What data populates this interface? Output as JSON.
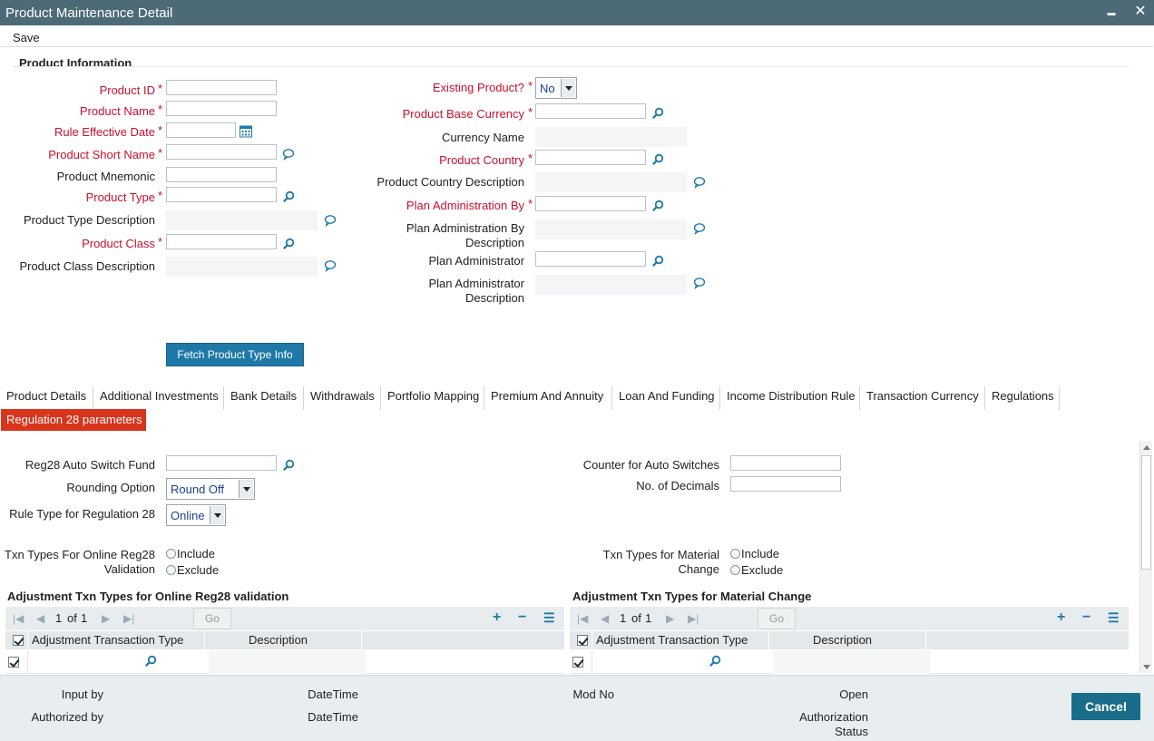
{
  "window": {
    "title": "Product Maintenance Detail",
    "minimize_glyph": "▬",
    "close_glyph": "✕"
  },
  "menu": {
    "save_label": "Save"
  },
  "product_info": {
    "section_title": "Product Information",
    "left": {
      "product_id": "Product ID",
      "product_name": "Product Name",
      "rule_effective_date": "Rule Effective Date",
      "product_short_name": "Product Short Name",
      "product_mnemonic": "Product Mnemonic",
      "product_type": "Product Type",
      "product_type_description": "Product Type Description",
      "product_class": "Product Class",
      "product_class_description": "Product Class Description"
    },
    "right": {
      "existing_product": "Existing Product?",
      "existing_product_value": "No",
      "product_base_currency": "Product Base Currency",
      "currency_name": "Currency Name",
      "product_country": "Product Country",
      "product_country_description": "Product Country Description",
      "plan_administration_by": "Plan Administration By",
      "plan_administration_by_description_1": "Plan Administration By",
      "plan_administration_by_description_2": "Description",
      "plan_administrator": "Plan Administrator",
      "plan_administrator_description_1": "Plan Administrator",
      "plan_administrator_description_2": "Description"
    },
    "required_star": "*",
    "fetch_button": "Fetch Product Type Info"
  },
  "tabs": [
    "Product Details",
    "Additional Investments",
    "Bank Details",
    "Withdrawals",
    "Portfolio Mapping",
    "Premium And Annuity",
    "Loan And Funding",
    "Income Distribution Rule",
    "Transaction Currency",
    "Regulations"
  ],
  "subtab": "Regulation 28 parameters",
  "reg28": {
    "auto_switch_fund": "Reg28 Auto Switch Fund",
    "rounding_option": "Rounding Option",
    "rounding_value": "Round Off",
    "rule_type": "Rule Type for Regulation 28",
    "rule_type_value": "Online",
    "counter_auto_switches": "Counter for Auto Switches",
    "no_of_decimals": "No. of Decimals",
    "txn_online_1": "Txn Types For Online Reg28",
    "txn_online_2": "Validation",
    "txn_material_1": "Txn Types for Material",
    "txn_material_2": "Change",
    "include": "Include",
    "exclude": "Exclude"
  },
  "grids": {
    "left_title": "Adjustment Txn Types for Online Reg28 validation",
    "right_title": "Adjustment Txn Types for Material Change",
    "page": "1",
    "of_label": "of",
    "total": "1",
    "go": "Go",
    "col_type": "Adjustment Transaction Type",
    "col_desc": "Description"
  },
  "footer": {
    "input_by": "Input by",
    "authorized_by": "Authorized by",
    "datetime1": "DateTime",
    "datetime2": "DateTime",
    "mod_no": "Mod No",
    "open": "Open",
    "auth_status_1": "Authorization",
    "auth_status_2": "Status",
    "cancel": "Cancel"
  },
  "colors": {
    "titlebar": "#4d6b77",
    "required": "#c8102e",
    "accent": "#1f79a8",
    "subtab": "#d9341c",
    "cancel": "#1a6d8a"
  },
  "icons": {
    "lookup": "search-icon",
    "comment": "comment-icon",
    "calendar": "calendar-icon"
  }
}
